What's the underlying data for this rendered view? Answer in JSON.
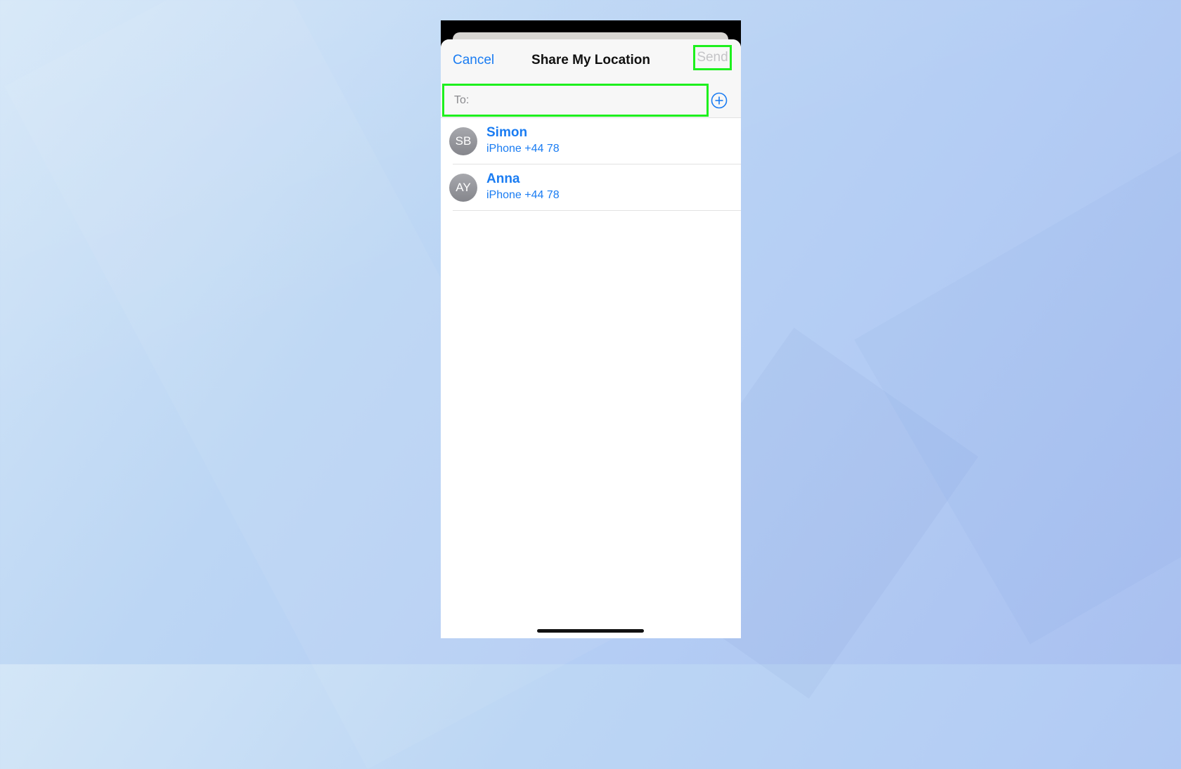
{
  "sheet": {
    "title": "Share My Location",
    "cancel_label": "Cancel",
    "send_label": "Send"
  },
  "to_field": {
    "label": "To:",
    "value": ""
  },
  "contacts": [
    {
      "initials": "SB",
      "name": "Simon",
      "detail": "iPhone +44 78"
    },
    {
      "initials": "AY",
      "name": "Anna",
      "detail": "iPhone +44 78"
    }
  ],
  "colors": {
    "accent": "#1a7cf2",
    "highlight": "#1ef01e",
    "disabled": "#c4c4c7"
  },
  "icons": {
    "add": "plus-circle-icon"
  }
}
